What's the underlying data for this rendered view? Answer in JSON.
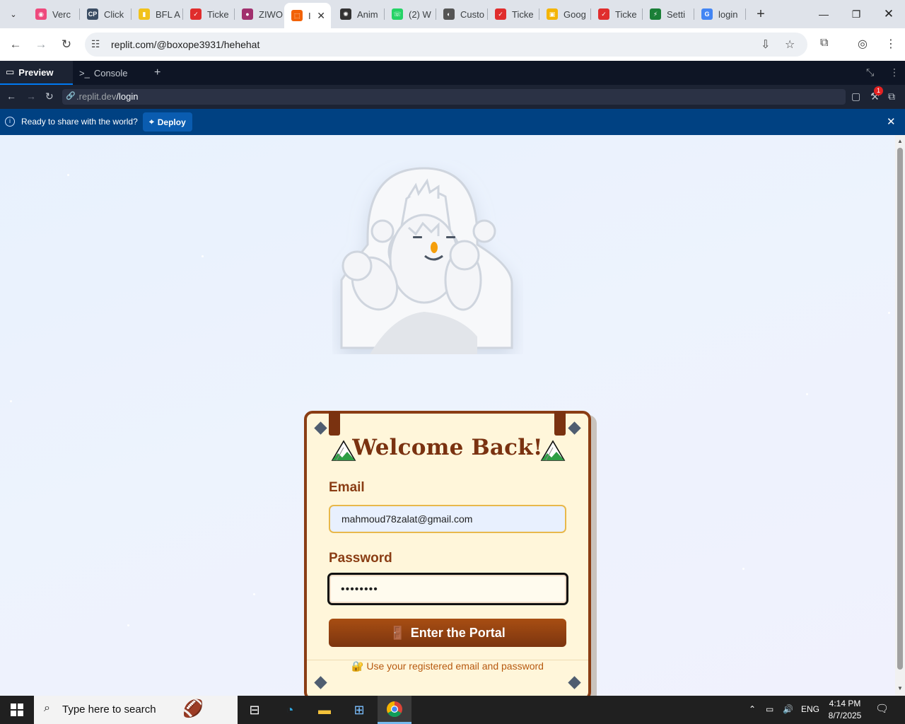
{
  "browser": {
    "tabs": [
      {
        "label": "Verc",
        "color": "#ee4a7d",
        "glyph": "◉"
      },
      {
        "label": "Click",
        "color": "#3b4d64",
        "glyph": "CP"
      },
      {
        "label": "BFL A",
        "color": "#f1c21b",
        "glyph": "▮"
      },
      {
        "label": "Ticke",
        "color": "#e02d2d",
        "glyph": "✓"
      },
      {
        "label": "ZIWO",
        "color": "#a1306e",
        "glyph": "●"
      },
      {
        "label": "I",
        "color": "#f26207",
        "glyph": "⬚",
        "active": true
      },
      {
        "label": "Anim",
        "color": "#333333",
        "glyph": "✺"
      },
      {
        "label": "(2) W",
        "color": "#25d366",
        "glyph": "☏"
      },
      {
        "label": "Custo",
        "color": "#555555",
        "glyph": "◐"
      },
      {
        "label": "Ticke",
        "color": "#e02d2d",
        "glyph": "✓"
      },
      {
        "label": "Goog",
        "color": "#f4b400",
        "glyph": "▣"
      },
      {
        "label": "Ticke",
        "color": "#e02d2d",
        "glyph": "✓"
      },
      {
        "label": "Setti",
        "color": "#1a7f37",
        "glyph": "⚡"
      },
      {
        "label": "login",
        "color": "#4285f4",
        "glyph": "G"
      }
    ],
    "url": "replit.com/@boxope3931/hehehat"
  },
  "replit": {
    "tab_preview": "Preview",
    "tab_console": "Console",
    "url_prefix": ".replit.dev",
    "url_path": "/login",
    "notification_count": "1",
    "banner_text": "Ready to share with the world?",
    "deploy_label": "Deploy"
  },
  "login": {
    "title": "Welcome Back!",
    "title_emoji_left": "⛰️",
    "title_emoji_right": "⛰️",
    "email_label": "Email",
    "email_value": "mahmoud78zalat@gmail.com",
    "password_label": "Password",
    "password_value": "••••••••",
    "submit_icon": "🚪",
    "submit_label": "Enter the Portal",
    "hint_icon": "🔐",
    "hint_text": "Use your registered email and password"
  },
  "taskbar": {
    "search_placeholder": "Type here to search",
    "lang": "ENG",
    "time": "4:14 PM",
    "date": "8/7/2025"
  },
  "colors": {
    "accent_brown": "#8a3d14",
    "card_bg": "#fff6da",
    "replit_banner": "#004182"
  }
}
